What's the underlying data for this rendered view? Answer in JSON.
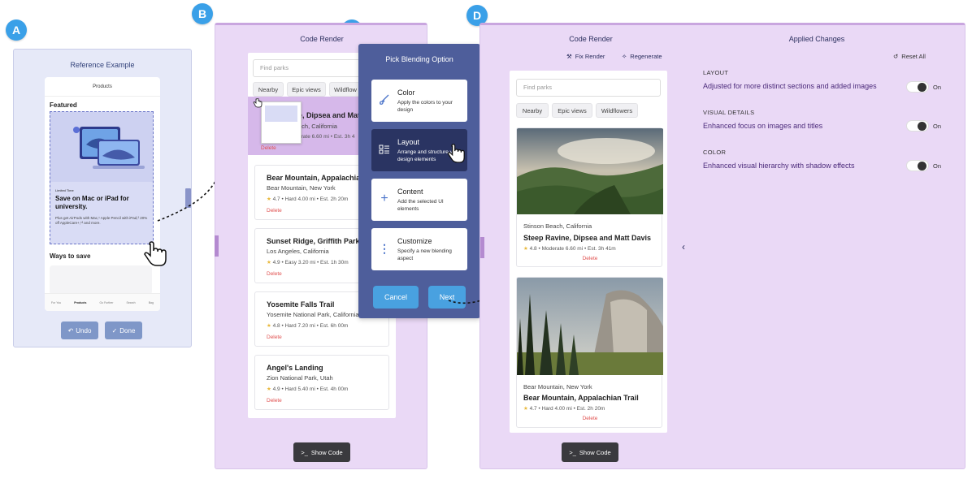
{
  "badges": {
    "a": "A",
    "b": "B",
    "c": "C",
    "d": "D"
  },
  "panel_a": {
    "title": "Reference Example",
    "phone": {
      "header": "Products",
      "featured": "Featured",
      "card": {
        "limited": "Limited Time",
        "headline": "Save on Mac or iPad for university.",
        "body": "Plus get AirPods with Mac,¹ Apple Pencil with iPad,² 20% off AppleCare+,¹³ and more."
      },
      "ways": "Ways to save",
      "tabs": [
        "For You",
        "Products",
        "Go Further",
        "Search",
        "Bag"
      ]
    },
    "undo": "Undo",
    "done": "Done"
  },
  "panel_b": {
    "title": "Code Render",
    "search_placeholder": "Find parks",
    "chips": [
      "Nearby",
      "Epic views",
      "Wildflow"
    ],
    "parks": [
      {
        "name": "e, Dipsea and Mat",
        "location": "ach, California",
        "meta": "erate  6.60 mi • Est. 3h 4",
        "delete": "Delete"
      },
      {
        "name": "Bear Mountain, Appalachian T",
        "location": "Bear Mountain, New York",
        "meta": "4.7 • Hard  4.00 mi • Est. 2h 20m",
        "delete": "Delete"
      },
      {
        "name": "Sunset Ridge, Griffith Park",
        "location": "Los Angeles, California",
        "meta": "4.9 • Easy  3.20 mi • Est. 1h 30m",
        "delete": "Delete"
      },
      {
        "name": "Yosemite Falls Trail",
        "location": "Yosemite National Park, California",
        "meta": "4.8 • Hard  7.20 mi • Est. 6h 00m",
        "delete": "Delete"
      },
      {
        "name": "Angel's Landing",
        "location": "Zion National Park, Utah",
        "meta": "4.9 • Hard  5.40 mi • Est. 4h 00m",
        "delete": "Delete"
      }
    ],
    "show_code": "Show Code"
  },
  "panel_c": {
    "title": "Pick Blending Option",
    "options": [
      {
        "name": "Color",
        "desc": "Apply the colors to your design"
      },
      {
        "name": "Layout",
        "desc": "Arrange and structure your design elements"
      },
      {
        "name": "Content",
        "desc": "Add the selected UI elements"
      },
      {
        "name": "Customize",
        "desc": "Specify a new blending aspect"
      }
    ],
    "cancel": "Cancel",
    "next": "Next"
  },
  "panel_d": {
    "title": "Code Render",
    "fix_render": "Fix Render",
    "regenerate": "Regenerate",
    "search_placeholder": "Find parks",
    "chips": [
      "Nearby",
      "Epic views",
      "Wildflowers"
    ],
    "parks": [
      {
        "location": "Stinson Beach, California",
        "name": "Steep Ravine, Dipsea and Matt Davis",
        "meta": "4.8 • Moderate  6.60 mi • Est. 3h 41m",
        "delete": "Delete"
      },
      {
        "location": "Bear Mountain, New York",
        "name": "Bear Mountain, Appalachian Trail",
        "meta": "4.7 • Hard  4.00 mi • Est. 2h 20m",
        "delete": "Delete"
      }
    ],
    "show_code": "Show Code",
    "applied_title": "Applied Changes",
    "reset_all": "Reset All",
    "changes": [
      {
        "label": "LAYOUT",
        "text": "Adjusted for more distinct sections and added images",
        "state": "On"
      },
      {
        "label": "VISUAL DETAILS",
        "text": "Enhanced focus on images and titles",
        "state": "On"
      },
      {
        "label": "COLOR",
        "text": "Enhanced visual hierarchy with shadow effects",
        "state": "On"
      }
    ]
  }
}
